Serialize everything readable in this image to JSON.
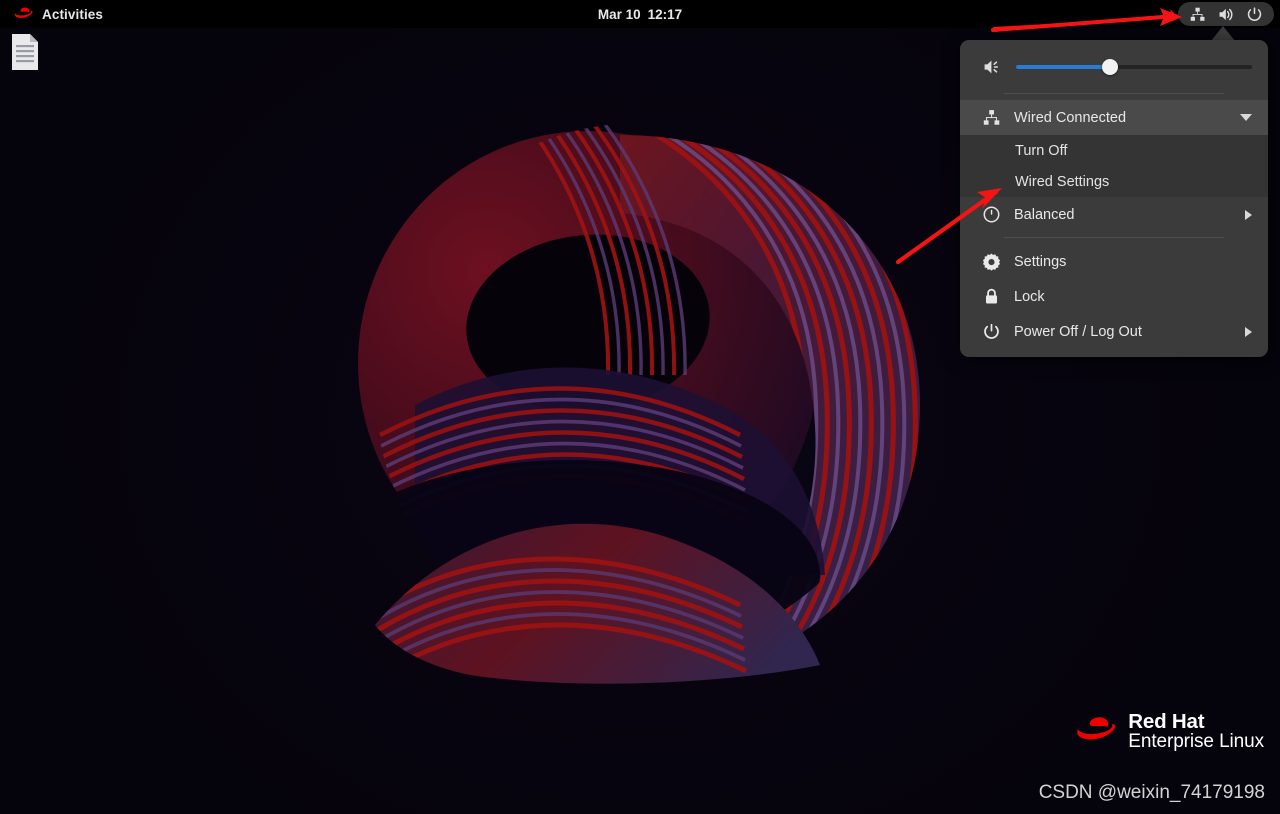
{
  "topbar": {
    "activities_label": "Activities",
    "activities_icon": "redhat-fedora-icon",
    "clock_date": "Mar 10",
    "clock_time": "12:17",
    "status_icons": [
      {
        "name": "network-wired-icon",
        "label": "Wired network"
      },
      {
        "name": "volume-high-icon",
        "label": "Volume"
      },
      {
        "name": "power-icon",
        "label": "Power"
      }
    ]
  },
  "system_menu": {
    "volume": {
      "icon": "volume-medium-icon",
      "value_percent": 40,
      "accent_color": "#2a7bd4"
    },
    "network": {
      "icon": "network-wired-icon",
      "label": "Wired Connected",
      "expanded": true,
      "expander_icon": "chevron-down-icon",
      "submenu": [
        {
          "label": "Turn Off"
        },
        {
          "label": "Wired Settings"
        }
      ]
    },
    "power_profile": {
      "icon": "gauge-icon",
      "label": "Balanced",
      "expander_icon": "chevron-right-icon"
    },
    "actions": [
      {
        "icon": "gear-icon",
        "label": "Settings",
        "has_submenu": false
      },
      {
        "icon": "lock-icon",
        "label": "Lock",
        "has_submenu": false
      },
      {
        "icon": "power-icon",
        "label": "Power Off / Log Out",
        "has_submenu": true
      }
    ]
  },
  "desktop": {
    "icon": {
      "name": "document-file-icon"
    },
    "branding": {
      "logo": "redhat-fedora-icon",
      "line1": "Red Hat",
      "line2": "Enterprise Linux"
    },
    "watermark": "CSDN @weixin_74179198",
    "wallpaper": {
      "name": "rhel9-swirl-nine",
      "background_color": "#05030b",
      "band_red": "#8b0f0f",
      "band_purple": "#5a3a6e",
      "band_navy": "#0d0a26"
    }
  },
  "annotations": {
    "color": "#f41414",
    "arrows": [
      {
        "name": "arrow-to-status-pill",
        "target": "status-pill"
      },
      {
        "name": "arrow-to-wired-settings",
        "target": "Wired Settings"
      }
    ]
  }
}
